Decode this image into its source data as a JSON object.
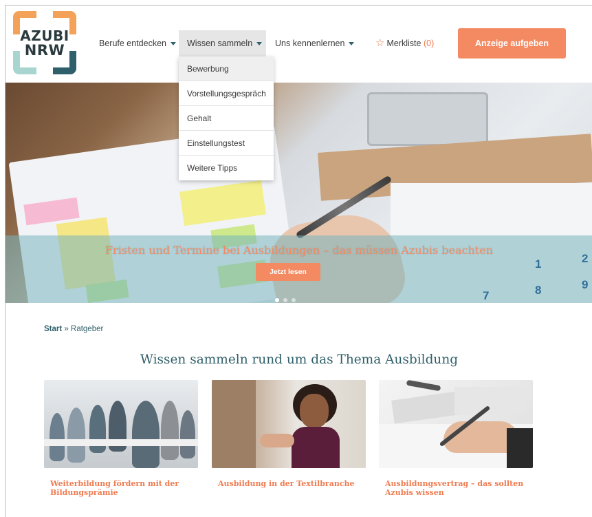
{
  "logo": {
    "line1": "AZUBI",
    "line2": "NRW"
  },
  "nav": {
    "items": [
      {
        "label": "Berufe entdecken"
      },
      {
        "label": "Wissen sammeln"
      },
      {
        "label": "Uns kennenlernen"
      }
    ],
    "merkliste_label": "Merkliste",
    "merkliste_count": "(0)",
    "cta_label": "Anzeige aufgeben"
  },
  "dropdown": {
    "items": [
      {
        "label": "Bewerbung"
      },
      {
        "label": "Vorstellungsgespräch"
      },
      {
        "label": "Gehalt"
      },
      {
        "label": "Einstellungstest"
      },
      {
        "label": "Weitere Tipps"
      }
    ]
  },
  "hero": {
    "title": "Fristen und Termine bei Ausbildungen – das müssen Azubis beachten",
    "button_label": "Jetzt lesen",
    "calendar_numbers": [
      "1",
      "2",
      "7",
      "8",
      "9"
    ]
  },
  "breadcrumb": {
    "start": "Start",
    "separator": "»",
    "current": "Ratgeber"
  },
  "heading": "Wissen sammeln rund um das Thema Ausbildung",
  "cards": [
    {
      "caption": "Weiterbildung fördern mit der Bildungsprämie"
    },
    {
      "caption": "Ausbildung in der Textilbranche"
    },
    {
      "caption": "Ausbildungsvertrag – das sollten Azubis wissen"
    }
  ],
  "colors": {
    "accent": "#f48a62",
    "brand_dark": "#2f5f6a",
    "logo_orange": "#f4a259",
    "logo_mint": "#a8d5cf"
  }
}
